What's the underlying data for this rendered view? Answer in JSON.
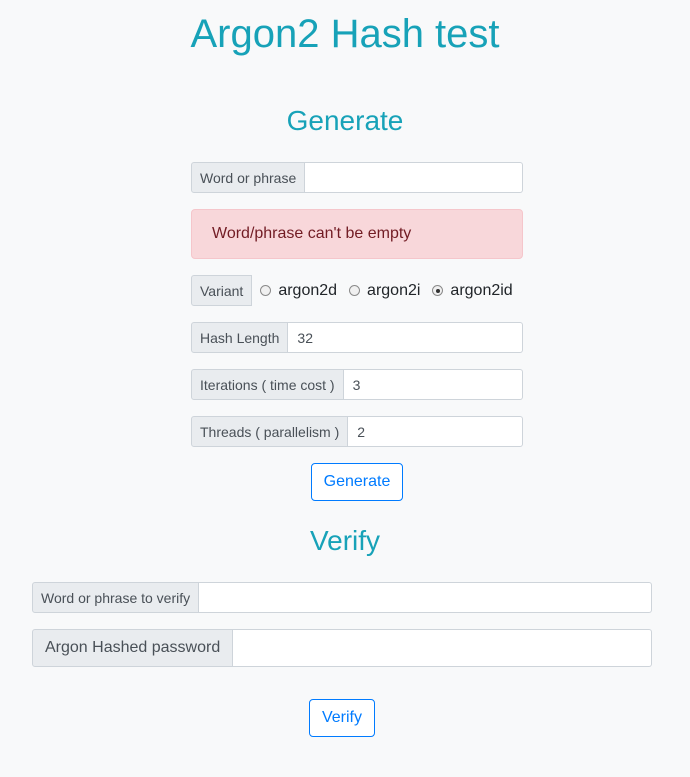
{
  "page": {
    "title": "Argon2 Hash test"
  },
  "generate": {
    "heading": "Generate",
    "word_label": "Word or phrase",
    "word_value": "",
    "error": "Word/phrase can't be empty",
    "variant_label": "Variant",
    "variants": [
      {
        "label": "argon2d",
        "checked": false
      },
      {
        "label": "argon2i",
        "checked": false
      },
      {
        "label": "argon2id",
        "checked": true
      }
    ],
    "hash_length_label": "Hash Length",
    "hash_length_value": "32",
    "iterations_label": "Iterations ( time cost )",
    "iterations_value": "3",
    "threads_label": "Threads ( parallelism )",
    "threads_value": "2",
    "button_label": "Generate"
  },
  "verify": {
    "heading": "Verify",
    "word_label": "Word or phrase to verify",
    "word_value": "",
    "hash_label": "Argon Hashed password",
    "hash_value": "",
    "button_label": "Verify"
  },
  "colors": {
    "heading": "#17a2b8",
    "button": "#007bff",
    "alert_bg": "#f8d7da",
    "alert_text": "#721c24"
  }
}
